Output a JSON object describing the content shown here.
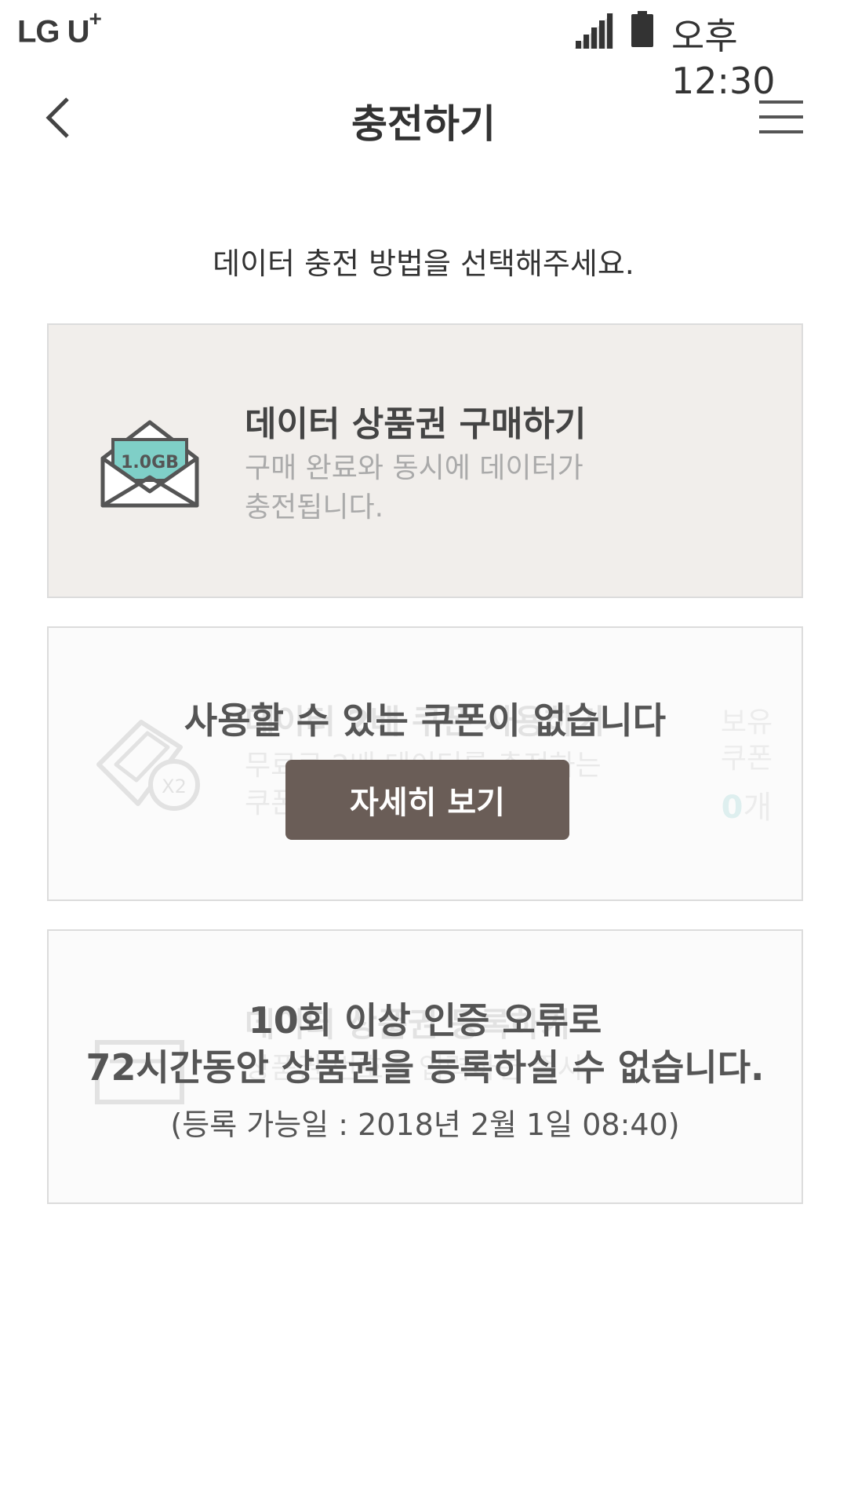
{
  "status_bar": {
    "carrier": "LG U",
    "carrier_plus": "+",
    "time": "오후 12:30"
  },
  "header": {
    "title": "충전하기",
    "back_icon": "chevron-left-icon",
    "menu_icon": "hamburger-menu-icon"
  },
  "subtitle": "데이터 충전 방법을 선택해주세요.",
  "options": [
    {
      "title": "데이터 상품권 구매하기",
      "description_line1": "구매 완료와 동시에 데이터가",
      "description_line2": "충전됩니다.",
      "icon": "envelope-icon",
      "icon_badge": "1.0GB",
      "accent_color": "#7fcfc7"
    },
    {
      "overlay_message": "사용할 수 있는 쿠폰이 없습니다",
      "detail_button_label": "자세히 보기",
      "icon": "coupon-icon",
      "faded_title": "데이터 2배 쿠폰 사용하기",
      "faded_text_line1": "무료로 2배 데이터를 충전하는",
      "faded_text_line2": "쿠폰",
      "owned_label_line1": "보유",
      "owned_label_line2": "쿠폰",
      "owned_count": "0",
      "owned_unit": "개",
      "button_color": "#6a5d57"
    },
    {
      "error_line1": "10회 이상 인증 오류로",
      "error_line2": "72시간동안 상품권을 등록하실 수 없습니다.",
      "error_date": "(등록 가능일 : 2018년 2월 1일 08:40)",
      "icon": "ticket-icon",
      "faded_title": "데이터 상품권 등록하기",
      "faded_text_line1": "상품권 번호를 입력하면 즉시"
    }
  ]
}
